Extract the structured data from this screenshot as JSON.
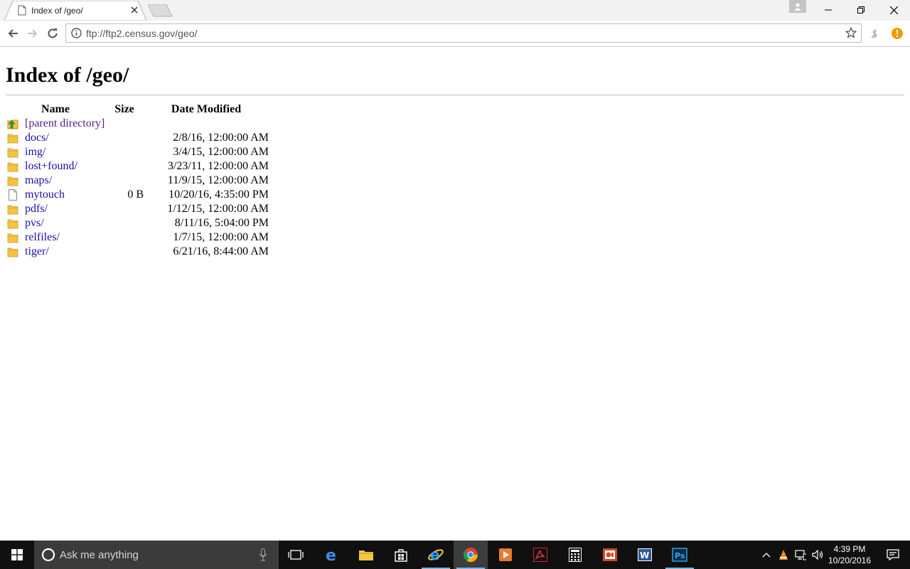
{
  "browser": {
    "tab_title": "Index of /geo/",
    "address": "ftp://ftp2.census.gov/geo/"
  },
  "page": {
    "heading": "Index of /geo/",
    "columns": {
      "name": "Name",
      "size": "Size",
      "date": "Date Modified"
    },
    "parent_label": "[parent directory]",
    "entries": [
      {
        "name": "docs/",
        "size": "",
        "date": "2/8/16, 12:00:00 AM",
        "type": "folder"
      },
      {
        "name": "img/",
        "size": "",
        "date": "3/4/15, 12:00:00 AM",
        "type": "folder"
      },
      {
        "name": "lost+found/",
        "size": "",
        "date": "3/23/11, 12:00:00 AM",
        "type": "folder"
      },
      {
        "name": "maps/",
        "size": "",
        "date": "11/9/15, 12:00:00 AM",
        "type": "folder"
      },
      {
        "name": "mytouch",
        "size": "0 B",
        "date": "10/20/16, 4:35:00 PM",
        "type": "file"
      },
      {
        "name": "pdfs/",
        "size": "",
        "date": "1/12/15, 12:00:00 AM",
        "type": "folder"
      },
      {
        "name": "pvs/",
        "size": "",
        "date": "8/11/16, 5:04:00 PM",
        "type": "folder"
      },
      {
        "name": "relfiles/",
        "size": "",
        "date": "1/7/15, 12:00:00 AM",
        "type": "folder"
      },
      {
        "name": "tiger/",
        "size": "",
        "date": "6/21/16, 8:44:00 AM",
        "type": "folder"
      }
    ]
  },
  "taskbar": {
    "search_placeholder": "Ask me anything",
    "time": "4:39 PM",
    "date": "10/20/2016",
    "apps": [
      "task-view",
      "edge",
      "file-explorer",
      "store",
      "internet-explorer",
      "chrome",
      "media-player",
      "acrobat",
      "calculator",
      "powerpoint",
      "word",
      "photoshop"
    ]
  },
  "colors": {
    "link": "#1a0dab",
    "visited_link": "#551a8b",
    "taskbar": "#101010",
    "folder": "#f5c542"
  }
}
